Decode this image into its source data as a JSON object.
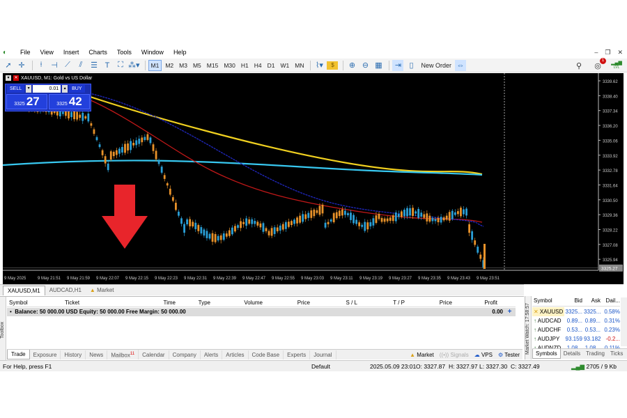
{
  "menu": [
    "File",
    "View",
    "Insert",
    "Charts",
    "Tools",
    "Window",
    "Help"
  ],
  "window_controls": [
    "–",
    "❐",
    "✕"
  ],
  "toolbar": {
    "timeframes": [
      "M1",
      "M2",
      "M3",
      "M5",
      "M15",
      "M30",
      "H1",
      "H4",
      "D1",
      "W1",
      "MN"
    ],
    "active_timeframe": "M1",
    "new_order_label": "New Order",
    "notification_count": "1",
    "signal_level": "LVL"
  },
  "chart": {
    "title": "XAUUSD, M1:  Gold vs US Dollar",
    "trade_panel": {
      "sell_label": "SELL",
      "buy_label": "BUY",
      "volume": "0.01",
      "sell_small": "3325",
      "sell_big": "27",
      "buy_small": "3325",
      "buy_big": "42"
    },
    "price_labels": [
      "3339.62",
      "3338.40",
      "3337.34",
      "3336.20",
      "3335.06",
      "3333.92",
      "3332.78",
      "3331.64",
      "3330.50",
      "3329.36",
      "3328.22",
      "3327.08",
      "3325.94"
    ],
    "current_price": "3325.27",
    "time_labels": [
      "9 May 2025",
      "9 May 21:51",
      "9 May 21:59",
      "9 May 22:07",
      "9 May 22:15",
      "9 May 22:23",
      "9 May 22:31",
      "9 May 22:39",
      "9 May 22:47",
      "9 May 22:55",
      "9 May 23:03",
      "9 May 23:11",
      "9 May 23:19",
      "9 May 23:27",
      "9 May 23:35",
      "9 May 23:43",
      "9 May 23:51"
    ],
    "colors": {
      "bull": "#2a9fd6",
      "bear": "#e8922a",
      "ma_yellow": "#f0d020",
      "ma_cyan": "#38c8f0",
      "ma_red": "#c01818",
      "ma_blue": "#2028c0",
      "arrow": "#e8252b"
    }
  },
  "chart_tabs": [
    "XAUUSD,M1",
    "AUDCAD,H1",
    "Market"
  ],
  "toolbox": {
    "side_label": "Toolbox",
    "columns": [
      "Symbol",
      "Ticket",
      "Time",
      "Type",
      "Volume",
      "Price",
      "S / L",
      "T / P",
      "Price",
      "Profit"
    ],
    "balance_text": "Balance: 50 000.00 USD  Equity: 50 000.00  Free Margin: 50 000.00",
    "balance_profit": "0.00",
    "tabs": [
      "Trade",
      "Exposure",
      "History",
      "News",
      "Mailbox",
      "Calendar",
      "Company",
      "Alerts",
      "Articles",
      "Code Base",
      "Experts",
      "Journal"
    ],
    "mailbox_count": "11",
    "right_items": [
      "Market",
      "Signals",
      "VPS",
      "Tester"
    ]
  },
  "market_watch": {
    "side_label": "Market Watch: 17:58:57",
    "columns": [
      "Symbol",
      "Bid",
      "Ask",
      "Dail..."
    ],
    "rows": [
      {
        "symbol": "XAUUSD",
        "bid": "3325...",
        "ask": "3325...",
        "daily": "0.58%",
        "daily_color": "#1a56c8"
      },
      {
        "symbol": "AUDCAD",
        "bid": "0.89...",
        "ask": "0.89...",
        "daily": "0.31%",
        "daily_color": "#1a56c8"
      },
      {
        "symbol": "AUDCHF",
        "bid": "0.53...",
        "ask": "0.53...",
        "daily": "0.23%",
        "daily_color": "#1a56c8"
      },
      {
        "symbol": "AUDJPY",
        "bid": "93.159",
        "ask": "93.182",
        "daily": "-0.2...",
        "daily_color": "#d01010"
      },
      {
        "symbol": "AUDNZD",
        "bid": "1.08...",
        "ask": "1.08...",
        "daily": "0.11%",
        "daily_color": "#1a56c8"
      }
    ],
    "tabs": [
      "Symbols",
      "Details",
      "Trading",
      "Ticks"
    ]
  },
  "status": {
    "help": "For Help, press F1",
    "profile": "Default",
    "datetime": "2025.05.09 23:01",
    "open": "O: 3327.87",
    "high": "H: 3327.97",
    "low": "L: 3327.30",
    "close": "C: 3327.49",
    "traffic": "2705 / 9 Kb"
  }
}
